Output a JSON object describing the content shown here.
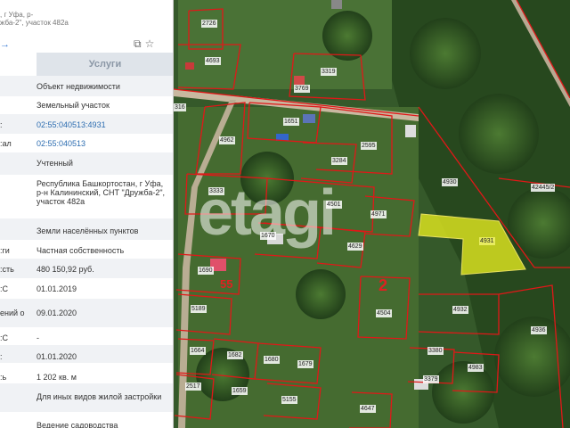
{
  "panel": {
    "address_lines": [
      ", г Уфа, р-",
      "жба-2\", участок 482а"
    ],
    "services_label": "Услуги",
    "rows": [
      {
        "key": "",
        "value": "Объект недвижимости"
      },
      {
        "key": "",
        "value": "Земельный участок"
      },
      {
        "key": ":",
        "value": "02:55:040513:4931",
        "link": true
      },
      {
        "key": "ал:",
        "value": "02:55:040513",
        "link": true
      },
      {
        "key": "",
        "value": "Учтенный"
      },
      {
        "key": "",
        "value": "Республика Башкортостан, г Уфа, р-н Калининский, СНТ \"Дружба-2\", участок 482а"
      },
      {
        "key": "",
        "value": "Земли населённых пунктов"
      },
      {
        "key": "ги:",
        "value": "Частная собственность"
      },
      {
        "key": "сть:",
        "value": "480 150,92 руб."
      },
      {
        "key": "С:",
        "value": "01.01.2019"
      },
      {
        "key": "ений о",
        "value": "09.01.2020"
      },
      {
        "key": "С:",
        "value": "-"
      },
      {
        "key": ":",
        "value": "01.01.2020"
      },
      {
        "key": "ь:",
        "value": "1 202 кв. м"
      },
      {
        "key": "",
        "value": "Для иных видов жилой застройки"
      },
      {
        "key": "",
        "value": "Ведение садоводства"
      }
    ]
  },
  "map": {
    "watermark": "etagi",
    "zone_labels": [
      "55",
      "2"
    ],
    "highlight_color": "#d8e020",
    "boundary_color": "#e01818",
    "plot_labels": [
      "2726",
      "4693",
      "3319",
      "3769",
      "316",
      "1651",
      "4962",
      "2595",
      "3284",
      "3333",
      "4930",
      "42445/2",
      "4501",
      "4971",
      "4931",
      "1670",
      "4629",
      "1690",
      "5189",
      "4504",
      "4932",
      "4936",
      "1664",
      "1682",
      "1680",
      "1679",
      "3380",
      "4983",
      "3379",
      "2517",
      "1659",
      "5155",
      "4647"
    ]
  }
}
